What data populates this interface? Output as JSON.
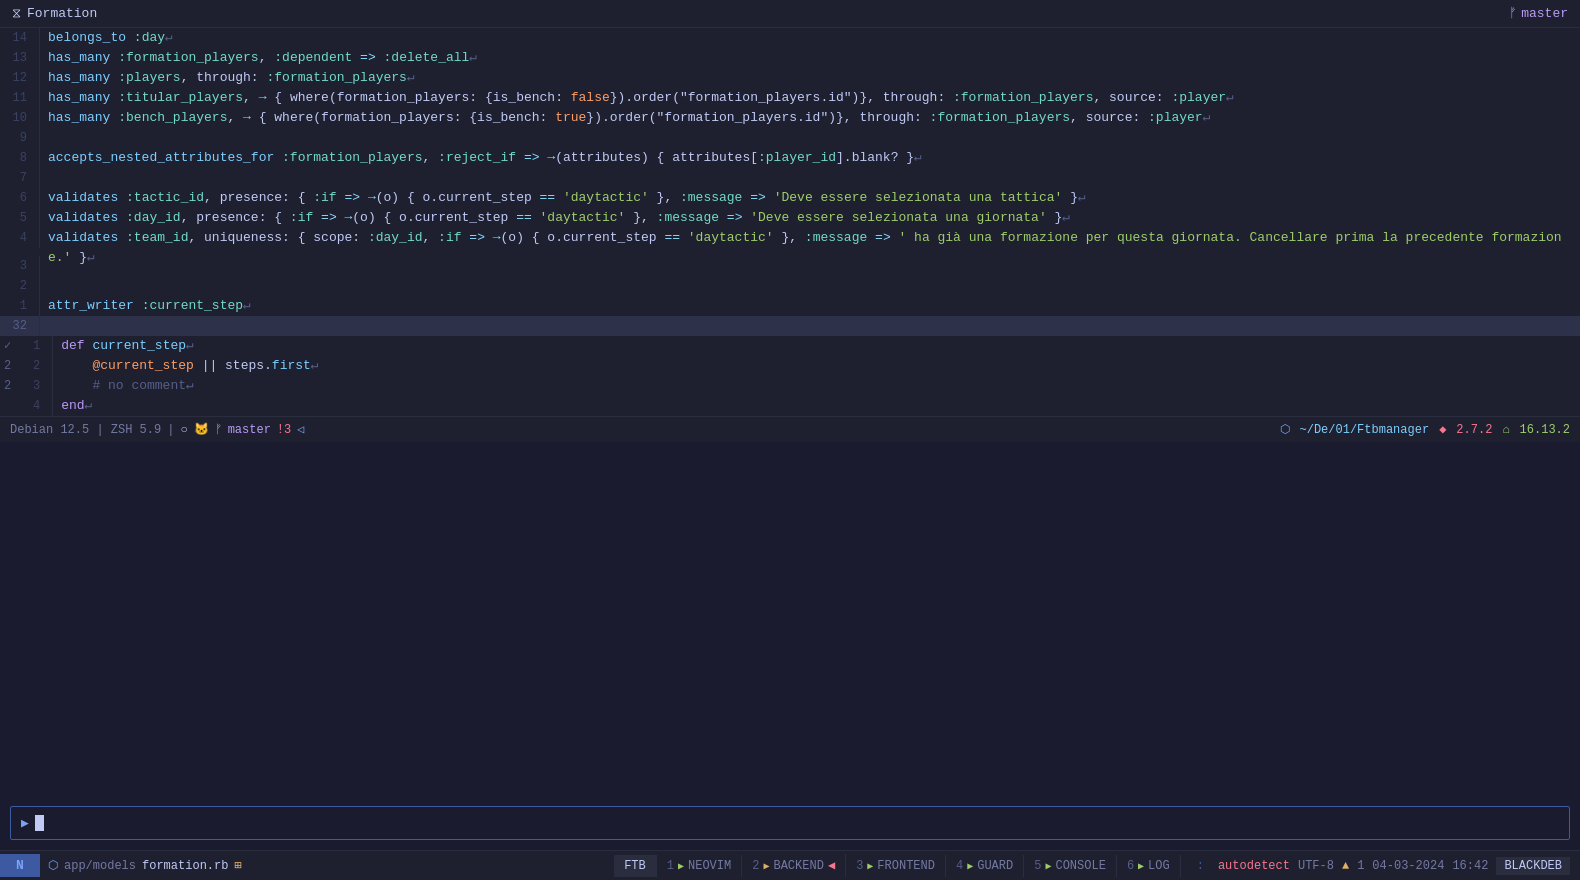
{
  "titleBar": {
    "title": "Formation",
    "icon": "⧖",
    "branch": "master",
    "branchIcon": "ᚠ"
  },
  "editor": {
    "lines": [
      {
        "num": "14",
        "content": "  belongs_to :day↵",
        "tokens": [
          {
            "t": "mth",
            "v": "belongs_to"
          },
          {
            "t": "sym",
            "v": " :day"
          },
          {
            "t": "var",
            "v": "↵"
          }
        ]
      },
      {
        "num": "13",
        "content": "  has_many :formation_players, :dependent => :delete_all↵",
        "tokens": [
          {
            "t": "mth",
            "v": "has_many"
          },
          {
            "t": "sym",
            "v": " :formation_players"
          },
          {
            "t": "var",
            "v": ", "
          },
          {
            "t": "sym",
            "v": ":dependent"
          },
          {
            "t": "op",
            "v": " => "
          },
          {
            "t": "sym",
            "v": ":delete_all"
          },
          {
            "t": "var",
            "v": "↵"
          }
        ]
      },
      {
        "num": "12",
        "content": "  has_many :players, through: :formation_players↵",
        "tokens": [
          {
            "t": "mth",
            "v": "has_many"
          },
          {
            "t": "sym",
            "v": " :players"
          },
          {
            "t": "var",
            "v": ", "
          },
          {
            "t": "sym",
            "v": "through:"
          },
          {
            "t": "sym",
            "v": " :formation_players"
          },
          {
            "t": "var",
            "v": "↵"
          }
        ]
      },
      {
        "num": "11",
        "content": "  has_many :titular_players, → { where(formation_players: {is_bench: false}).order(\"formation_players.id\")}, through: :formation_players, source: :player↵"
      },
      {
        "num": "10",
        "content": "  has_many :bench_players, → { where(formation_players: {is_bench: true}).order(\"formation_players.id\")}, through: :formation_players, source: :player↵"
      },
      {
        "num": "9",
        "content": ""
      },
      {
        "num": "8",
        "content": "  accepts_nested_attributes_for :formation_players, :reject_if => →(attributes) { attributes[:player_id].blank? }↵"
      },
      {
        "num": "7",
        "content": ""
      },
      {
        "num": "6",
        "content": "  validates :tactic_id, presence: { :if => →(o) { o.current_step == 'daytactic' }, :message => 'Deve essere selezionata una tattica' }↵"
      },
      {
        "num": "5",
        "content": "  validates :day_id, presence: { :if => →(o) { o.current_step == 'daytactic' }, :message => 'Deve essere selezionata una giornata' }↵"
      },
      {
        "num": "4",
        "content": "  validates :team_id, uniqueness: { scope: :day_id, :if => →(o) { o.current_step == 'daytactic' }, :message => ' ha già una formazione per questa giornata. Cancellare prima la precedente formazione.' }↵"
      },
      {
        "num": "3",
        "content": ""
      },
      {
        "num": "2",
        "content": ""
      },
      {
        "num": "1",
        "content": "  attr_writer :current_step↵"
      },
      {
        "num": "32",
        "content": "",
        "separator": true
      },
      {
        "num": "1",
        "content": "  def current_step↵"
      },
      {
        "num": "2",
        "content": "    @current_step || steps.first↵"
      },
      {
        "num": "3",
        "content": "    # no comment↵"
      },
      {
        "num": "4",
        "content": "  end↵"
      }
    ]
  },
  "statusBarMid": {
    "left": "Debian 12.5 | ZSH 5.9",
    "branch": "master",
    "branchNum": "!3",
    "path": "~/De/01/Ftbmanager",
    "rubyVersion": "2.7.2",
    "nodeVersion": "16.13.2"
  },
  "terminal": {
    "prompt": "▶",
    "inputPlaceholder": ""
  },
  "bottomBar": {
    "mode": "N",
    "folderIcon": "⬡",
    "folder": "app/models",
    "fileName": "formation.rb",
    "modifiedIcon": "⊞",
    "tabs": [
      {
        "num": "FTB",
        "label": "FTB",
        "active": true,
        "type": "mode"
      },
      {
        "num": "1",
        "label": "NEOVIM",
        "icon": "▶",
        "active": false
      },
      {
        "num": "2",
        "label": "BACKEND",
        "icon": "▶",
        "running": true
      },
      {
        "num": "3",
        "label": "FRONTEND",
        "icon": "▶",
        "active": false
      },
      {
        "num": "4",
        "label": "GUARD",
        "icon": "▶",
        "active": false
      },
      {
        "num": "5",
        "label": "CONSOLE",
        "icon": "▶",
        "active": false
      },
      {
        "num": "6",
        "label": "LOG",
        "icon": "▶",
        "active": false
      }
    ],
    "colons": ":",
    "rightStatus": {
      "encoding": "UTF-8",
      "lineNum": "1",
      "date": "04-03-2024",
      "time": "16:42",
      "os": "BLACKDEB"
    }
  }
}
